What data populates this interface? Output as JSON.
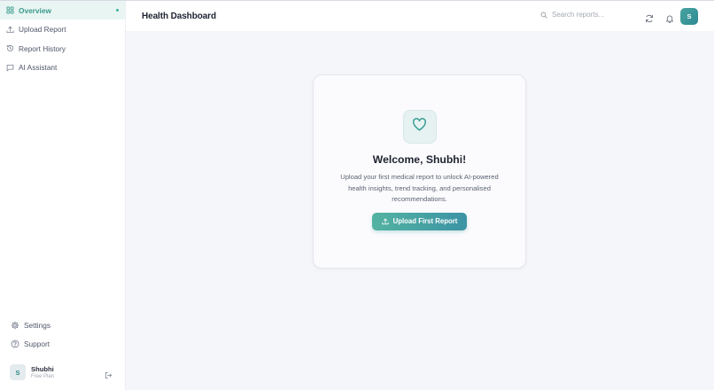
{
  "sidebar": {
    "nav": [
      {
        "label": "Overview",
        "icon": "dashboard-icon",
        "active": true
      },
      {
        "label": "Upload Report",
        "icon": "upload-icon",
        "active": false
      },
      {
        "label": "Report History",
        "icon": "history-icon",
        "active": false
      },
      {
        "label": "AI Assistant",
        "icon": "chat-icon",
        "active": false
      }
    ],
    "bottom": [
      {
        "label": "Settings",
        "icon": "gear-icon"
      },
      {
        "label": "Support",
        "icon": "help-circle-icon"
      }
    ],
    "user": {
      "initial": "S",
      "name": "Shubhi",
      "plan": "Free Plan"
    }
  },
  "header": {
    "title": "Health Dashboard",
    "search_placeholder": "Search reports...",
    "avatar_initial": "S"
  },
  "welcome_card": {
    "icon": "heart-icon",
    "title": "Welcome, Shubhi!",
    "description": "Upload your first medical report to unlock AI-powered health insights, trend tracking, and personalised recommendations.",
    "button_label": "Upload First Report"
  },
  "colors": {
    "accent": "#3fae9c",
    "active_bg": "#e9f5f3",
    "button_gradient_start": "#53b3a2",
    "button_gradient_end": "#3c93a4"
  }
}
